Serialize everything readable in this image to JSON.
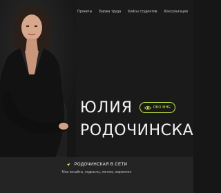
{
  "nav": {
    "items": [
      {
        "label": "Проекты"
      },
      {
        "label": "Биржа труда"
      },
      {
        "label": "Кейсы студентов"
      },
      {
        "label": "Консультации"
      }
    ]
  },
  "hero": {
    "name_line1": "ЮЛИЯ",
    "name_line2": "РОДОЧИНСКАЯ",
    "about_label": "ОБО МНЕ",
    "accent_color": "#c9f246"
  },
  "online": {
    "title": "РОДОЧИНСКАЯ В СЕТИ",
    "subtitle": "Мои инсайты, подкасты, личное, маркетинг"
  },
  "icons": {
    "about": "eye-icon",
    "online": "send-arrow-icon"
  }
}
